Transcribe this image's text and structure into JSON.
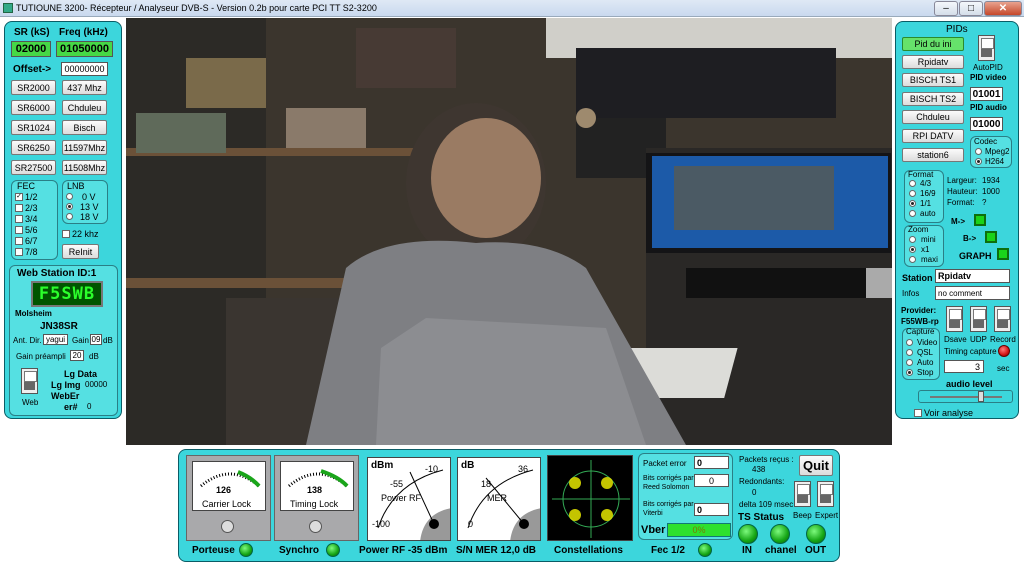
{
  "window": {
    "title": "TUTIOUNE 3200-  Récepteur / Analyseur DVB-S - Version 0.2b pour carte PCI TT S2-3200",
    "minimize": "–",
    "maximize": "□",
    "close": "✕"
  },
  "left": {
    "sr_label": "SR (kS)",
    "freq_label": "Freq (kHz)",
    "sr_value": "02000",
    "freq_value": "01050000",
    "offset_label": "Offset->",
    "offset_value": "00000000",
    "presets": [
      [
        "SR2000",
        "437 Mhz"
      ],
      [
        "SR6000",
        "Chduleu"
      ],
      [
        "SR1024",
        "Bisch"
      ],
      [
        "SR6250",
        "11597Mhz"
      ],
      [
        "SR27500",
        "11508Mhz"
      ]
    ],
    "fec_title": "FEC",
    "fec": [
      "1/2",
      "2/3",
      "3/4",
      "5/6",
      "6/7",
      "7/8"
    ],
    "fec_checked": "1/2",
    "lnb_title": "LNB",
    "lnb": [
      "0 V",
      "13 V",
      "18 V"
    ],
    "lnb_selected": "13 V",
    "khz22": "22 khz",
    "reinit": "ReInit",
    "web_title": "Web Station ID:1",
    "callsign": "F5SWB",
    "city": "Molsheim",
    "locator": "JN38SR",
    "ant_label": "Ant. Dir.",
    "ant_value": "yagui",
    "gain_label": "Gain",
    "gain_value": "09",
    "gain_unit": "dB",
    "preamp_label": "Gain préampli",
    "preamp_value": "20",
    "preamp_unit": "dB",
    "lg_data": "Lg Data",
    "lg_img": "Lg Img",
    "lg_img_val": "00000",
    "weber": "WebEr",
    "err": "er#",
    "err_val": "0",
    "web": "Web"
  },
  "right": {
    "pids_title": "PIDs",
    "pid_buttons": [
      "Pid du  ini",
      "Rpidatv",
      "BISCH TS1",
      "BISCH TS2",
      "Chduleu",
      "RPI DATV",
      "station6"
    ],
    "autopid": "AutoPID",
    "pid_video_label": "PID video",
    "pid_video": "01001",
    "pid_audio_label": "PID audio",
    "pid_audio": "01000",
    "codec_title": "Codec",
    "codecs": [
      "Mpeg2",
      "H264"
    ],
    "codec_selected": "H264",
    "format_title": "Format",
    "formats": [
      "4/3",
      "16/9",
      "1/1",
      "auto"
    ],
    "format_selected": "1/1",
    "largeur_label": "Largeur:",
    "largeur": "1934",
    "hauteur_label": "Hauteur:",
    "hauteur": "1000",
    "fmt_label": "Format:",
    "fmt": "?",
    "zoom_title": "Zoom",
    "zooms": [
      "mini",
      "x1",
      "maxi"
    ],
    "zoom_selected": "x1",
    "m_label": "M->",
    "b_label": "B->",
    "graph": "GRAPH",
    "station_label": "Station",
    "station": "Rpidatv",
    "infos_label": "Infos",
    "infos": "no comment",
    "provider_label": "Provider:",
    "provider": "F55WB-rp",
    "capture_title": "Capture",
    "captures": [
      "Video",
      "QSL",
      "Auto",
      "Stop"
    ],
    "capture_selected": "Stop",
    "dsave": "Dsave",
    "udp": "UDP",
    "record": "Record",
    "timing_label": "Timing capture",
    "timing_value": "3",
    "sec": "sec",
    "audio_level": "audio level",
    "voir": "Voir analyse"
  },
  "bottom": {
    "g1_value": "126",
    "g1_label": "Carrier Lock",
    "g2_value": "138",
    "g2_label": "Timing Lock",
    "rf_unit": "dBm",
    "rf_a": "-55",
    "rf_b": "-10",
    "rf_c": "-100",
    "rf_label": "Power RF",
    "mer_unit": "dB",
    "mer_a": "18",
    "mer_b": "36",
    "mer_c": "0",
    "mer_label": "MER",
    "packet_error": "Packet error",
    "packet_error_val": "0",
    "bits_rs": "Bits corrigés par Reed Solomon",
    "bits_rs_val": "0",
    "bits_vit": "Bits corrigés par Viterbi",
    "bits_vit_val": "0",
    "vber": "Vber",
    "vber_val": "0%",
    "packets_label": "Packets reçus :",
    "packets": "438",
    "redondants_label": "Redondants:",
    "redondants": "0",
    "delta": "delta 109 msec",
    "quit": "Quit",
    "ts_status": "TS Status",
    "beep": "Beep",
    "expert": "Expert",
    "porteuse": "Porteuse",
    "synchro": "Synchro",
    "power_rf": "Power RF -35 dBm",
    "snmer": "S/N MER  12,0 dB",
    "constellations": "Constellations",
    "fec": "Fec 1/2",
    "in": "IN",
    "chanel": "chanel",
    "out": "OUT"
  }
}
